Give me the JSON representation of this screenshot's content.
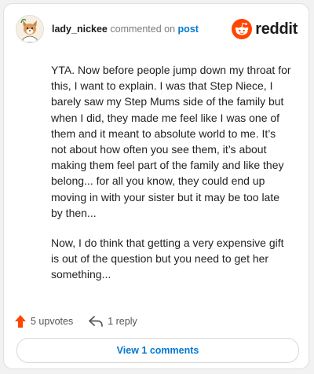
{
  "comment": {
    "username": "lady_nickee",
    "action_text": "commented on",
    "post_link_label": "post",
    "paragraphs": [
      "YTA. Now before people jump down my throat for this, I want to explain. I was that Step Niece, I barely saw my Step Mums side of the family but when I did, they made me feel like I was one of them and it meant to absolute world to me. It’s not about how often you see them, it’s about making them feel part of the family and like they belong... for all you know, they could end up moving in with your sister but it may be too late by then...",
      "Now, I do think that getting a very expensive gift is out of the question but you need to get her something..."
    ]
  },
  "brand": {
    "wordmark": "reddit",
    "icon": "reddit-logo-icon",
    "color": "#ff4500"
  },
  "footer": {
    "upvotes_label": "5 upvotes",
    "replies_label": "1 reply",
    "upvote_icon": "upvote-arrow-icon",
    "reply_icon": "reply-arrow-icon",
    "upvote_color": "#ff4500"
  },
  "view_comments_label": "View 1 comments",
  "colors": {
    "link": "#0079d3",
    "username": "#1c1c1c",
    "muted": "#7c7c7c"
  }
}
